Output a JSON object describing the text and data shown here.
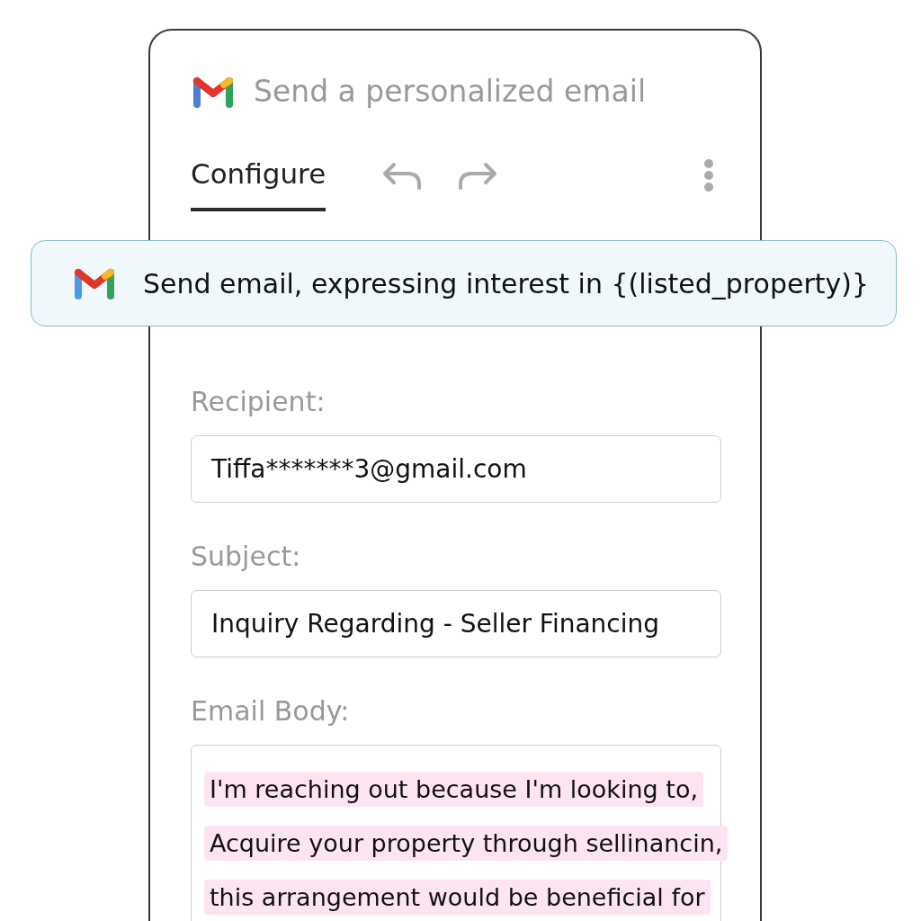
{
  "header": {
    "title": "Send a personalized email"
  },
  "tabs": [
    {
      "label": "Configure",
      "selected": true
    }
  ],
  "step": {
    "text": "Send email, expressing interest in {(listed_property)}"
  },
  "fields": [
    {
      "label": "Recipient:",
      "value": "Tiffa*******3@gmail.com"
    },
    {
      "label": "Subject:",
      "value": "Inquiry Regarding - Seller Financing"
    }
  ],
  "body": {
    "label": "Email Body:",
    "lines": [
      "I'm reaching out because I'm looking to,",
      "Acquire your property through sellinancin,",
      "this arrangement would be beneficial for"
    ]
  }
}
